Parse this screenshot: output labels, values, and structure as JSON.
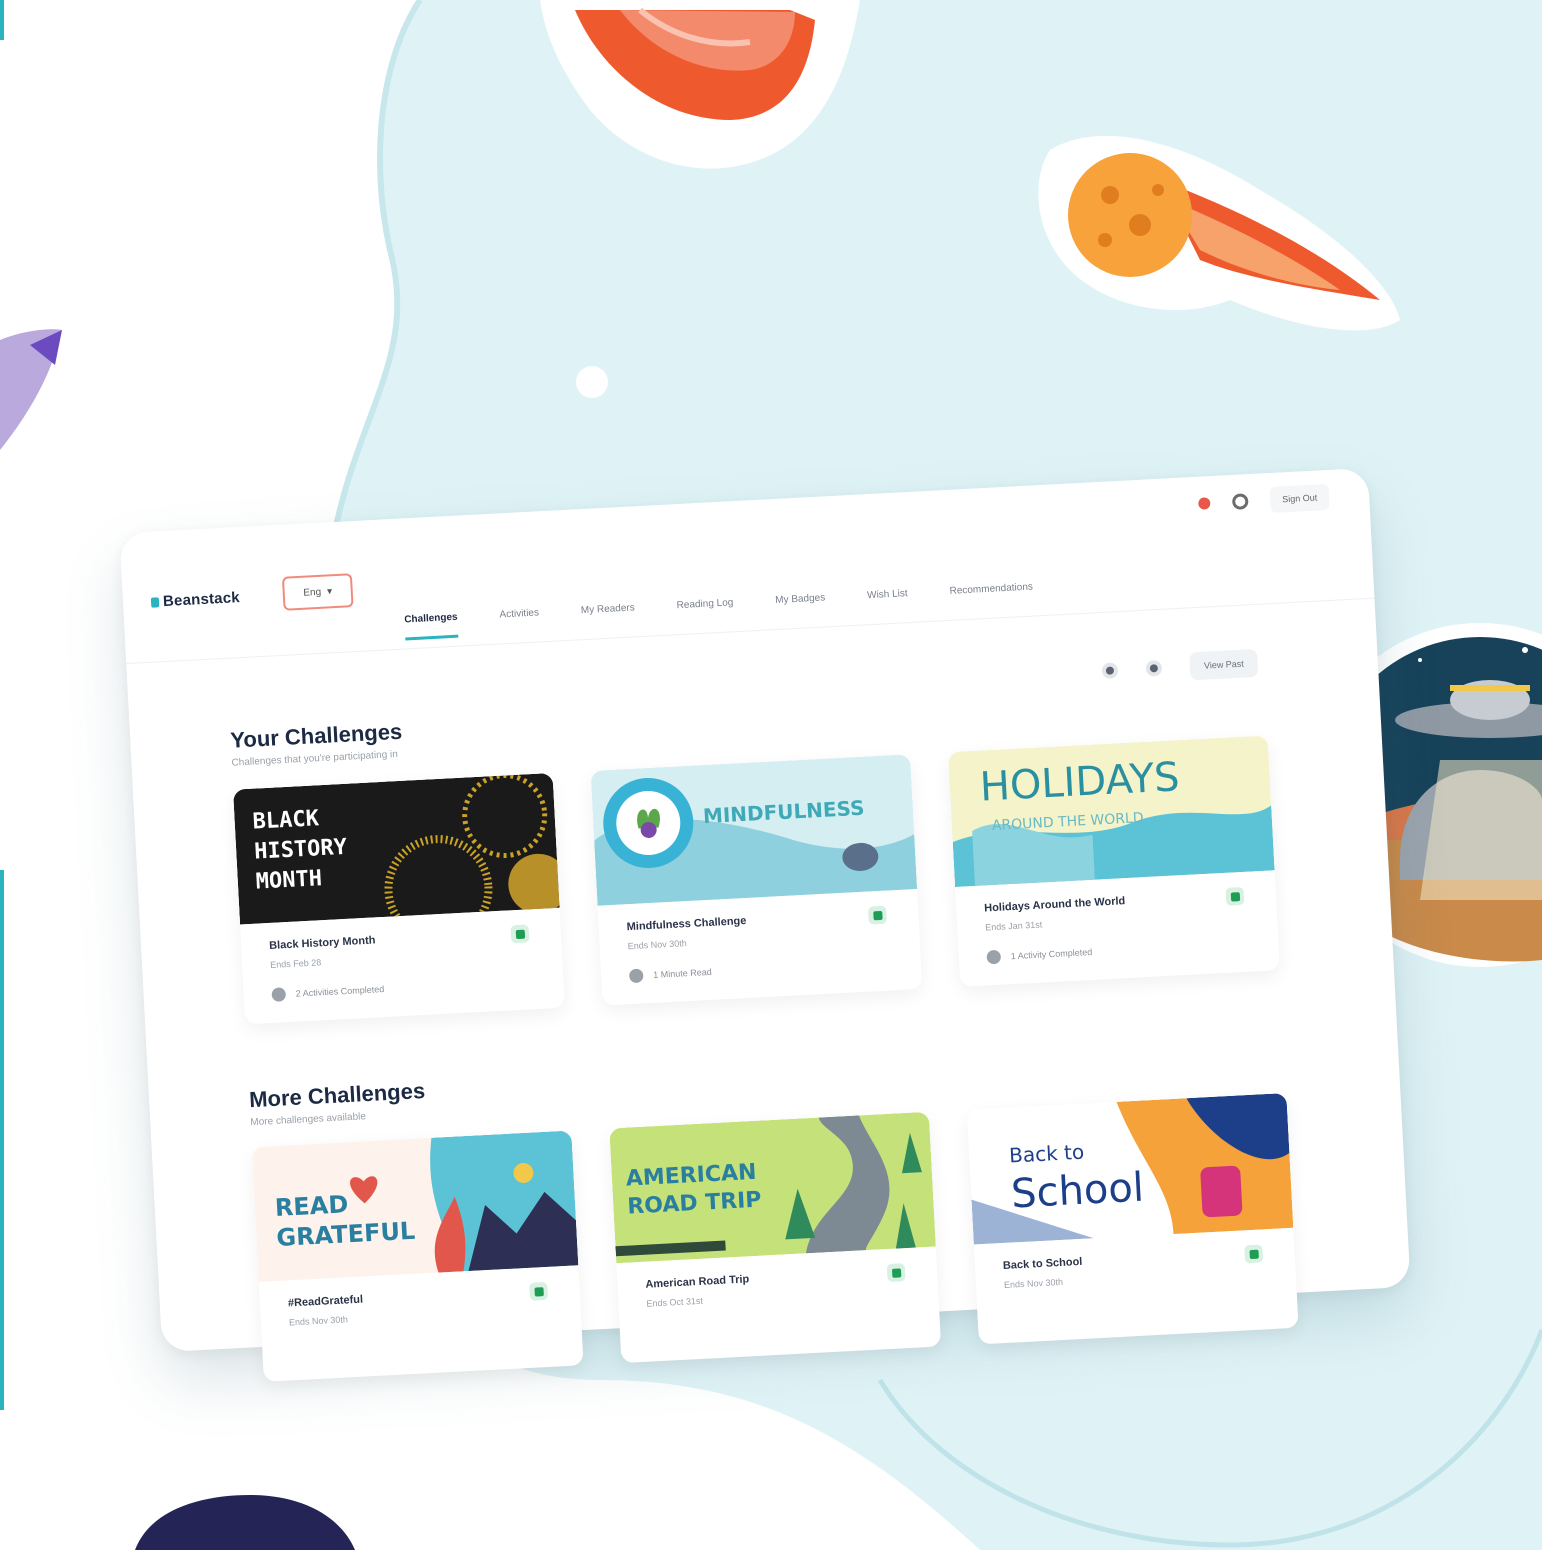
{
  "app": {
    "brand": "Beanstack",
    "language": "Eng",
    "signout_label": "Sign Out"
  },
  "tabs": [
    {
      "label": "Challenges",
      "active": true
    },
    {
      "label": "Activities"
    },
    {
      "label": "My Readers"
    },
    {
      "label": "Reading Log"
    },
    {
      "label": "My Badges"
    },
    {
      "label": "Wish List"
    },
    {
      "label": "Recommendations"
    }
  ],
  "toolbar": {
    "view_label": "View Past"
  },
  "your_challenges": {
    "title": "Your Challenges",
    "subtitle": "Challenges that you're participating in",
    "cards": [
      {
        "banner_text": "BLACK HISTORY MONTH",
        "title": "Black History Month",
        "date": "Ends Feb 28",
        "progress": "2 Activities Completed"
      },
      {
        "banner_text": "MINDFULNESS",
        "title": "Mindfulness Challenge",
        "date": "Ends Nov 30th",
        "progress": "1 Minute Read"
      },
      {
        "banner_text": "HOLIDAYS AROUND THE WORLD",
        "title": "Holidays Around the World",
        "date": "Ends Jan 31st",
        "progress": "1 Activity Completed"
      }
    ]
  },
  "more_challenges": {
    "title": "More Challenges",
    "subtitle": "More challenges available",
    "cards": [
      {
        "banner_text": "READ GRATEFUL",
        "title": "#ReadGrateful",
        "date": "Ends Nov 30th"
      },
      {
        "banner_text": "AMERICAN ROAD TRIP",
        "title": "American Road Trip",
        "date": "Ends Oct 31st"
      },
      {
        "banner_text_1": "Back to",
        "banner_text_2": "School",
        "title": "Back to School",
        "date": "Ends Nov 30th"
      }
    ]
  },
  "colors": {
    "accent": "#2bb3c0",
    "bg_blob": "#dff3f6",
    "check_green": "#1f9d55",
    "lang_border": "#f08b7d"
  }
}
